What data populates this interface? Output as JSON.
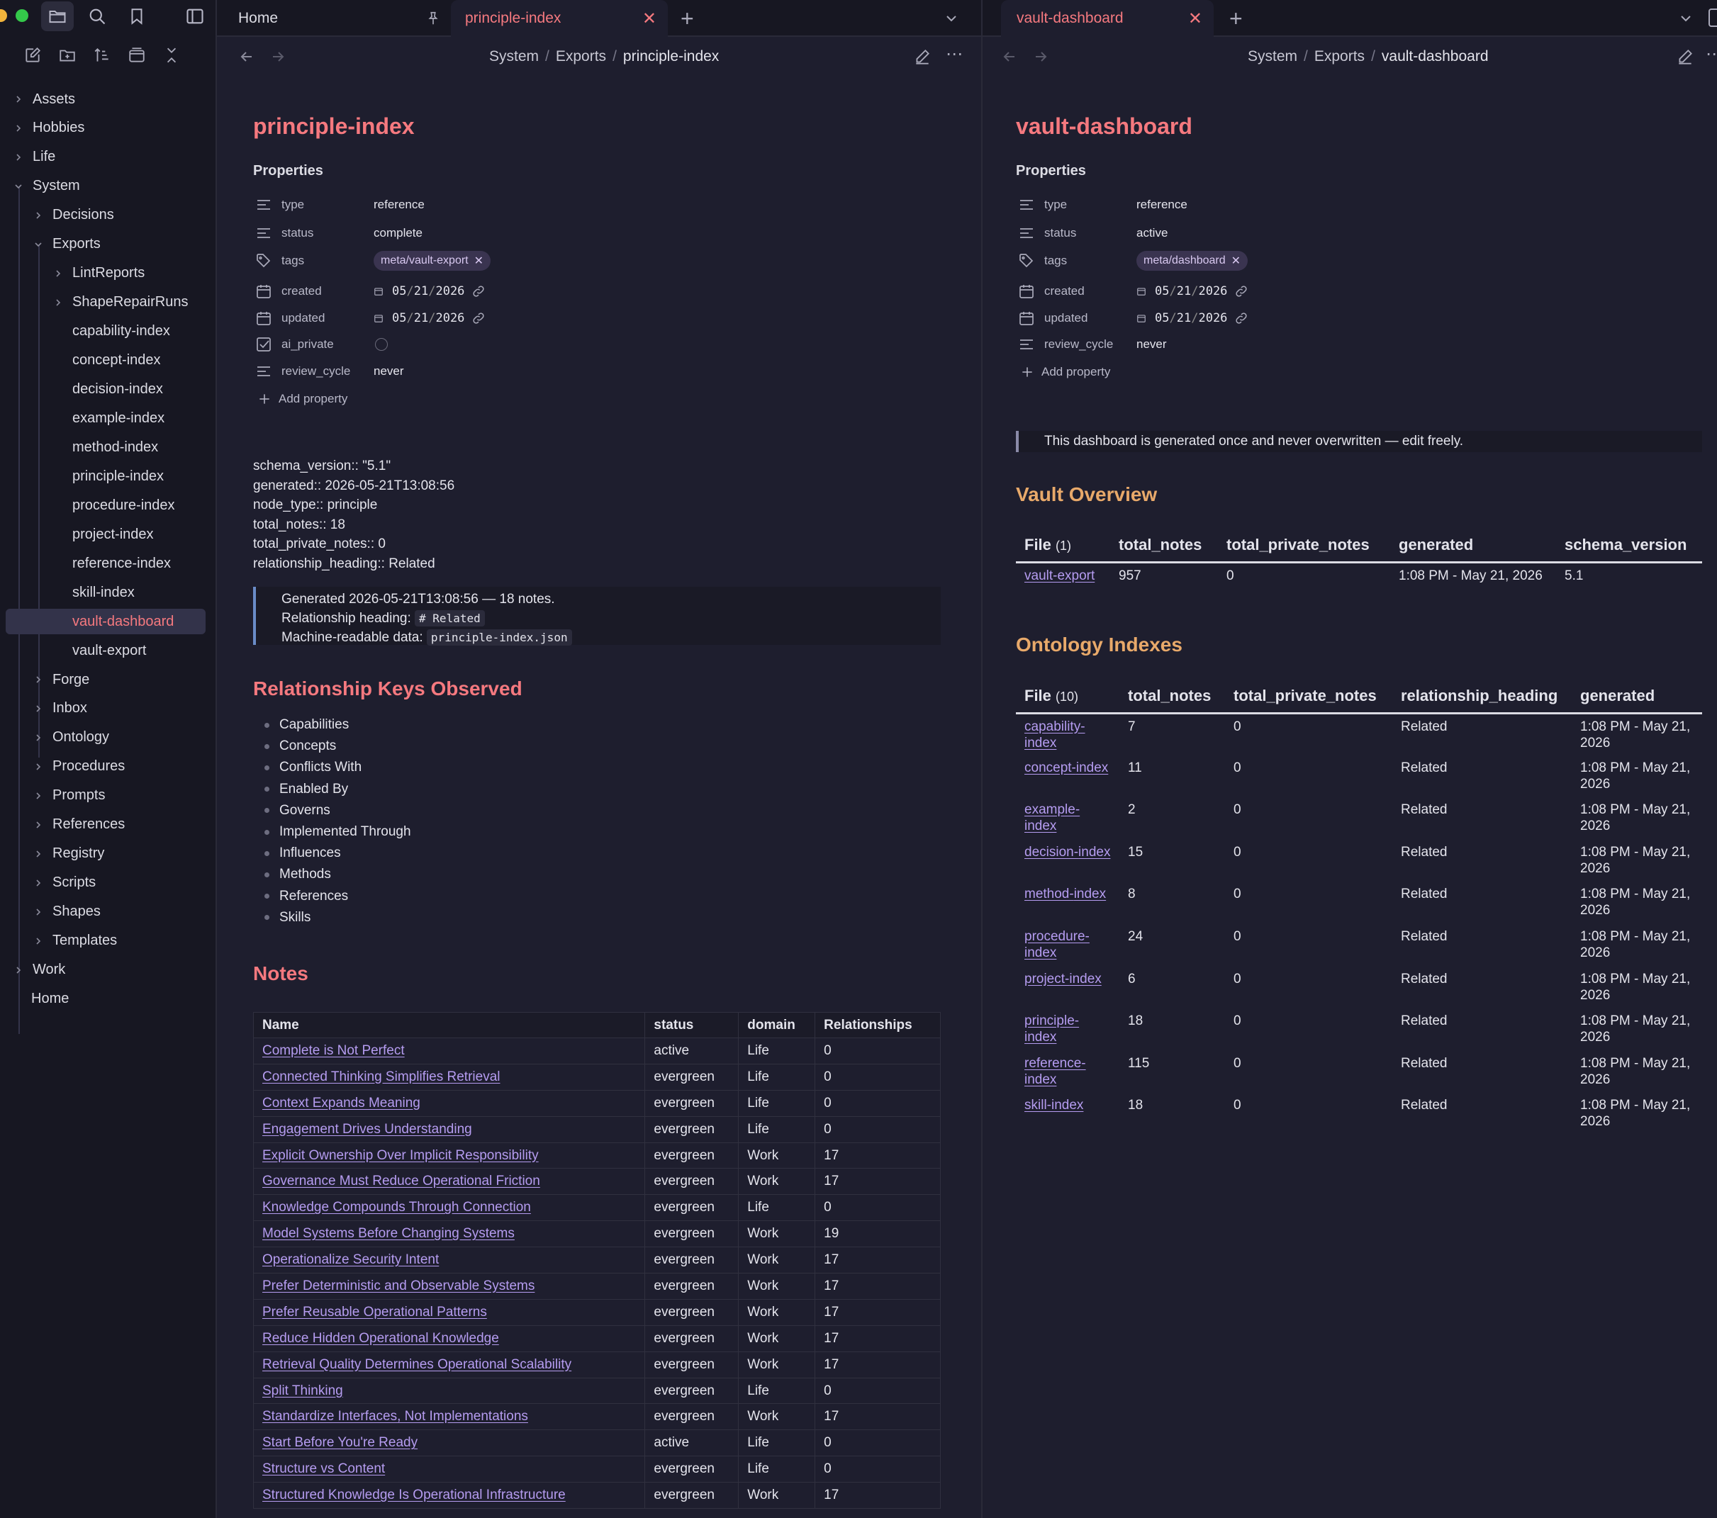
{
  "sidebar": {
    "tree": [
      {
        "label": "Assets",
        "depth": 0,
        "kind": "folder-collapsed"
      },
      {
        "label": "Hobbies",
        "depth": 0,
        "kind": "folder-collapsed"
      },
      {
        "label": "Life",
        "depth": 0,
        "kind": "folder-collapsed"
      },
      {
        "label": "System",
        "depth": 0,
        "kind": "folder-expanded"
      },
      {
        "label": "Decisions",
        "depth": 1,
        "kind": "folder-collapsed"
      },
      {
        "label": "Exports",
        "depth": 1,
        "kind": "folder-expanded"
      },
      {
        "label": "LintReports",
        "depth": 2,
        "kind": "folder-collapsed"
      },
      {
        "label": "ShapeRepairRuns",
        "depth": 2,
        "kind": "folder-collapsed"
      },
      {
        "label": "capability-index",
        "depth": 2,
        "kind": "file"
      },
      {
        "label": "concept-index",
        "depth": 2,
        "kind": "file"
      },
      {
        "label": "decision-index",
        "depth": 2,
        "kind": "file"
      },
      {
        "label": "example-index",
        "depth": 2,
        "kind": "file"
      },
      {
        "label": "method-index",
        "depth": 2,
        "kind": "file"
      },
      {
        "label": "principle-index",
        "depth": 2,
        "kind": "file"
      },
      {
        "label": "procedure-index",
        "depth": 2,
        "kind": "file"
      },
      {
        "label": "project-index",
        "depth": 2,
        "kind": "file"
      },
      {
        "label": "reference-index",
        "depth": 2,
        "kind": "file"
      },
      {
        "label": "skill-index",
        "depth": 2,
        "kind": "file"
      },
      {
        "label": "vault-dashboard",
        "depth": 2,
        "kind": "file",
        "selected": true
      },
      {
        "label": "vault-export",
        "depth": 2,
        "kind": "file"
      },
      {
        "label": "Forge",
        "depth": 1,
        "kind": "folder-collapsed"
      },
      {
        "label": "Inbox",
        "depth": 1,
        "kind": "folder-collapsed"
      },
      {
        "label": "Ontology",
        "depth": 1,
        "kind": "folder-collapsed"
      },
      {
        "label": "Procedures",
        "depth": 1,
        "kind": "folder-collapsed"
      },
      {
        "label": "Prompts",
        "depth": 1,
        "kind": "folder-collapsed"
      },
      {
        "label": "References",
        "depth": 1,
        "kind": "folder-collapsed"
      },
      {
        "label": "Registry",
        "depth": 1,
        "kind": "folder-collapsed"
      },
      {
        "label": "Scripts",
        "depth": 1,
        "kind": "folder-collapsed"
      },
      {
        "label": "Shapes",
        "depth": 1,
        "kind": "folder-collapsed"
      },
      {
        "label": "Templates",
        "depth": 1,
        "kind": "folder-collapsed"
      },
      {
        "label": "Work",
        "depth": 0,
        "kind": "folder-collapsed"
      },
      {
        "label": "Home",
        "depth": 0,
        "kind": "file"
      }
    ]
  },
  "tabs_left": {
    "home": "Home",
    "active": "principle-index",
    "close": "✕",
    "new": "+"
  },
  "tabs_right": {
    "active": "vault-dashboard",
    "close": "✕",
    "new": "+"
  },
  "left": {
    "breadcrumb": [
      "System",
      "Exports",
      "principle-index"
    ],
    "title": "principle-index",
    "properties_label": "Properties",
    "properties": [
      {
        "key": "type",
        "value": "reference",
        "icon": "text"
      },
      {
        "key": "status",
        "value": "complete",
        "icon": "text"
      },
      {
        "key": "tags",
        "value": "meta/vault-export",
        "icon": "tag"
      },
      {
        "key": "created",
        "month": "05",
        "day": "21",
        "year": "2026",
        "icon": "calendar"
      },
      {
        "key": "updated",
        "month": "05",
        "day": "21",
        "year": "2026",
        "icon": "calendar"
      },
      {
        "key": "ai_private",
        "value": "",
        "icon": "checkbox"
      },
      {
        "key": "review_cycle",
        "value": "never",
        "icon": "text"
      }
    ],
    "add_property": "Add property",
    "inline_fields": [
      "schema_version:: \"5.1\"",
      "generated:: 2026-05-21T13:08:56",
      "node_type:: principle",
      "total_notes:: 18",
      "total_private_notes:: 0",
      "relationship_heading:: Related"
    ],
    "callout": {
      "line1": "Generated 2026-05-21T13:08:56 — 18 notes.",
      "line2_label": "Relationship heading:",
      "line2_code": "# Related",
      "line3_label": "Machine-readable data:",
      "line3_code": "principle-index.json"
    },
    "rel_heading": "Relationship Keys Observed",
    "rel_keys": [
      "Capabilities",
      "Concepts",
      "Conflicts With",
      "Enabled By",
      "Governs",
      "Implemented Through",
      "Influences",
      "Methods",
      "References",
      "Skills"
    ],
    "notes_heading": "Notes",
    "notes_columns": [
      "Name",
      "status",
      "domain",
      "Relationships"
    ],
    "notes_rows": [
      [
        "Complete is Not Perfect",
        "active",
        "Life",
        "0"
      ],
      [
        "Connected Thinking Simplifies Retrieval",
        "evergreen",
        "Life",
        "0"
      ],
      [
        "Context Expands Meaning",
        "evergreen",
        "Life",
        "0"
      ],
      [
        "Engagement Drives Understanding",
        "evergreen",
        "Life",
        "0"
      ],
      [
        "Explicit Ownership Over Implicit Responsibility",
        "evergreen",
        "Work",
        "17"
      ],
      [
        "Governance Must Reduce Operational Friction",
        "evergreen",
        "Work",
        "17"
      ],
      [
        "Knowledge Compounds Through Connection",
        "evergreen",
        "Life",
        "0"
      ],
      [
        "Model Systems Before Changing Systems",
        "evergreen",
        "Work",
        "19"
      ],
      [
        "Operationalize Security Intent",
        "evergreen",
        "Work",
        "17"
      ],
      [
        "Prefer Deterministic and Observable Systems",
        "evergreen",
        "Work",
        "17"
      ],
      [
        "Prefer Reusable Operational Patterns",
        "evergreen",
        "Work",
        "17"
      ],
      [
        "Reduce Hidden Operational Knowledge",
        "evergreen",
        "Work",
        "17"
      ],
      [
        "Retrieval Quality Determines Operational Scalability",
        "evergreen",
        "Work",
        "17"
      ],
      [
        "Split Thinking",
        "evergreen",
        "Life",
        "0"
      ],
      [
        "Standardize Interfaces, Not Implementations",
        "evergreen",
        "Work",
        "17"
      ],
      [
        "Start Before You're Ready",
        "active",
        "Life",
        "0"
      ],
      [
        "Structure vs Content",
        "evergreen",
        "Life",
        "0"
      ],
      [
        "Structured Knowledge Is Operational Infrastructure",
        "evergreen",
        "Work",
        "17"
      ]
    ]
  },
  "right": {
    "breadcrumb": [
      "System",
      "Exports",
      "vault-dashboard"
    ],
    "title": "vault-dashboard",
    "properties_label": "Properties",
    "properties": [
      {
        "key": "type",
        "value": "reference",
        "icon": "text"
      },
      {
        "key": "status",
        "value": "active",
        "icon": "text"
      },
      {
        "key": "tags",
        "value": "meta/dashboard",
        "icon": "tag"
      },
      {
        "key": "created",
        "month": "05",
        "day": "21",
        "year": "2026",
        "icon": "calendar"
      },
      {
        "key": "updated",
        "month": "05",
        "day": "21",
        "year": "2026",
        "icon": "calendar"
      },
      {
        "key": "review_cycle",
        "value": "never",
        "icon": "text"
      }
    ],
    "add_property": "Add property",
    "quote": "This dashboard is generated once and never overwritten — edit freely.",
    "overview_heading": "Vault Overview",
    "overview_file_label": "File",
    "overview_file_count": "(1)",
    "overview_columns": [
      "total_notes",
      "total_private_notes",
      "generated",
      "schema_version"
    ],
    "overview_rows": [
      [
        "vault-export",
        "957",
        "0",
        "1:08 PM - May 21, 2026",
        "5.1"
      ]
    ],
    "onto_heading": "Ontology Indexes",
    "onto_file_label": "File",
    "onto_file_count": "(10)",
    "onto_columns": [
      "total_notes",
      "total_private_notes",
      "relationship_heading",
      "generated"
    ],
    "onto_rows": [
      [
        "capability-index",
        "7",
        "0",
        "Related",
        "1:08 PM - May 21, 2026"
      ],
      [
        "concept-index",
        "11",
        "0",
        "Related",
        "1:08 PM - May 21, 2026"
      ],
      [
        "example-index",
        "2",
        "0",
        "Related",
        "1:08 PM - May 21, 2026"
      ],
      [
        "decision-index",
        "15",
        "0",
        "Related",
        "1:08 PM - May 21, 2026"
      ],
      [
        "method-index",
        "8",
        "0",
        "Related",
        "1:08 PM - May 21, 2026"
      ],
      [
        "procedure-index",
        "24",
        "0",
        "Related",
        "1:08 PM - May 21, 2026"
      ],
      [
        "project-index",
        "6",
        "0",
        "Related",
        "1:08 PM - May 21, 2026"
      ],
      [
        "principle-index",
        "18",
        "0",
        "Related",
        "1:08 PM - May 21, 2026"
      ],
      [
        "reference-index",
        "115",
        "0",
        "Related",
        "1:08 PM - May 21, 2026"
      ],
      [
        "skill-index",
        "18",
        "0",
        "Related",
        "1:08 PM - May 21, 2026"
      ]
    ]
  },
  "colors": {
    "accent_red": "#f5797f",
    "heading_orange": "#e8a96a",
    "link_purple": "#b59cf0",
    "bg": "#1e1e2e"
  }
}
